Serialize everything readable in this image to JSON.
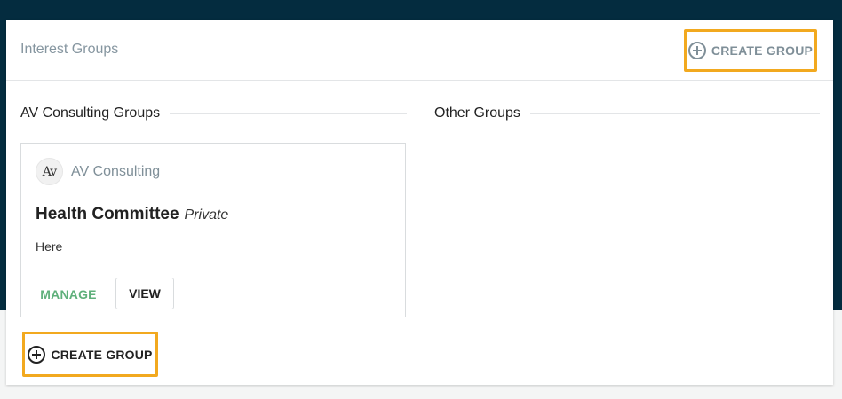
{
  "header": {
    "title": "Interest Groups",
    "create_label": "CREATE GROUP"
  },
  "sections": {
    "own": {
      "title": "AV Consulting Groups"
    },
    "other": {
      "title": "Other Groups"
    }
  },
  "group_card": {
    "org_logo_text": "Av",
    "org_name": "AV Consulting",
    "group_name": "Health Committee",
    "privacy": "Private",
    "description": "Here",
    "manage_label": "MANAGE",
    "view_label": "VIEW"
  },
  "footer": {
    "create_label": "CREATE GROUP"
  },
  "colors": {
    "topbar": "#042c3f",
    "highlight": "#f2a91f",
    "manage": "#5fb07b"
  },
  "icons": [
    "plus-circle-icon"
  ]
}
